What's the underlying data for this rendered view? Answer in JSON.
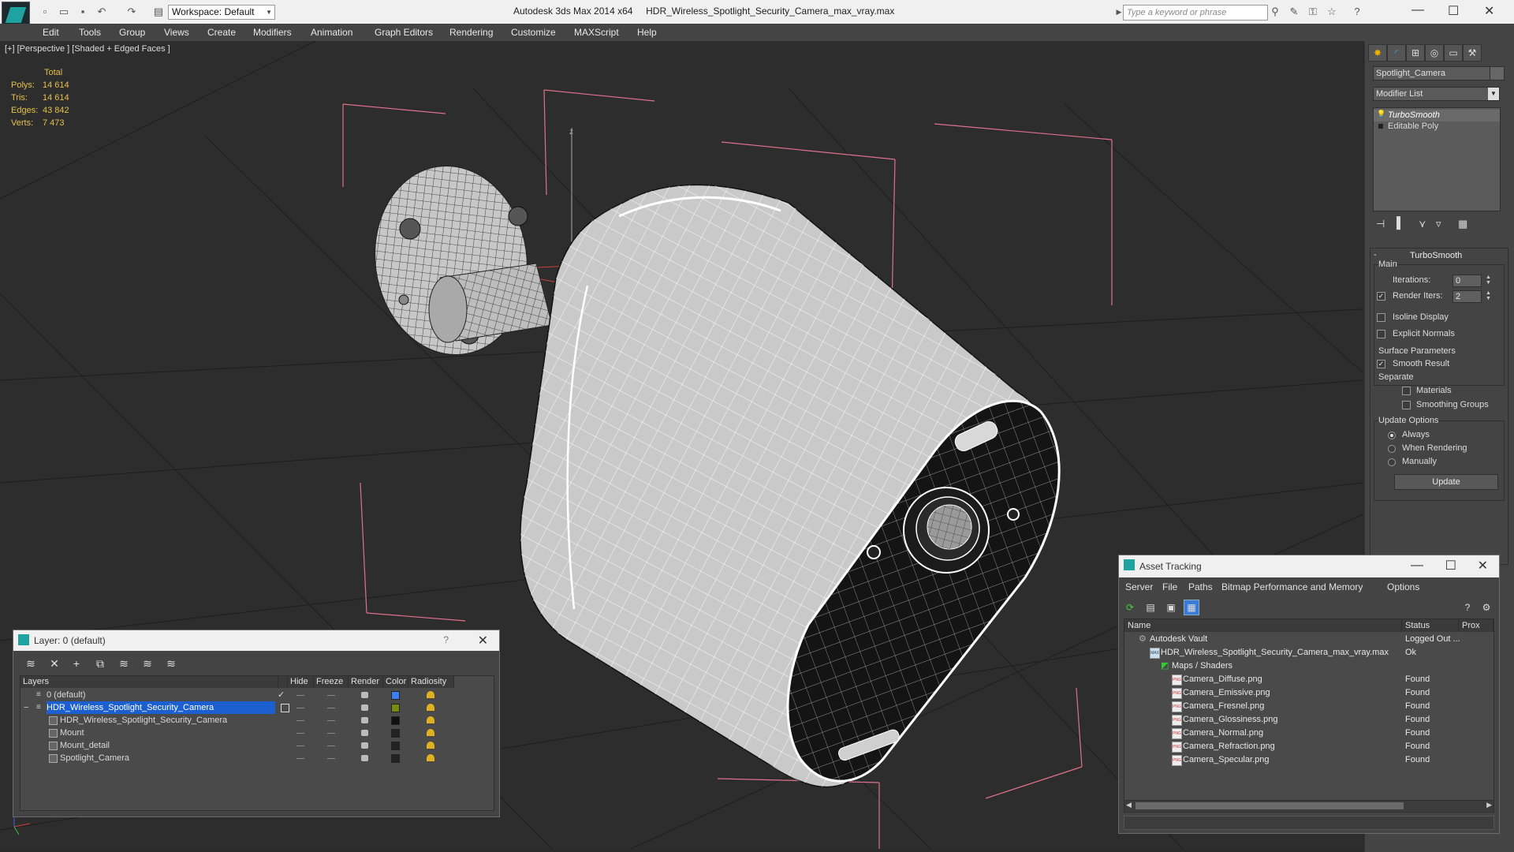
{
  "window": {
    "app_title": "Autodesk 3ds Max  2014 x64",
    "file_title": "HDR_Wireless_Spotlight_Security_Camera_max_vray.max",
    "workspace": "Workspace: Default",
    "search_placeholder": "Type a keyword or phrase"
  },
  "menu": [
    "Edit",
    "Tools",
    "Group",
    "Views",
    "Create",
    "Modifiers",
    "Animation",
    "Graph Editors",
    "Rendering",
    "Customize",
    "MAXScript",
    "Help"
  ],
  "viewport": {
    "label": "[+] [Perspective ] [Shaded + Edged Faces ]",
    "stats_header": "Total",
    "stats": [
      {
        "k": "Polys:",
        "v": "14 614"
      },
      {
        "k": "Tris:",
        "v": "14 614"
      },
      {
        "k": "Edges:",
        "v": "43 842"
      },
      {
        "k": "Verts:",
        "v": "7 473"
      }
    ],
    "colors": {
      "bg": "#2d2d2d",
      "bbox": "#e07090",
      "mesh_fill": "#c9c9c9",
      "wire": "#ffffff"
    }
  },
  "command_panel": {
    "object_name": "Spotlight_Camera",
    "modifier_list": "Modifier List",
    "stack": [
      "TurboSmooth",
      "Editable Poly"
    ],
    "rollout_title": "TurboSmooth",
    "main_group": "Main",
    "iterations_label": "Iterations:",
    "iterations_value": "0",
    "render_iters_label": "Render Iters:",
    "render_iters_value": "2",
    "render_iters_checked": true,
    "isoline_label": "Isoline Display",
    "explicit_normals_label": "Explicit Normals",
    "surface_group": "Surface Parameters",
    "smooth_result_label": "Smooth Result",
    "separate_label": "Separate",
    "materials_label": "Materials",
    "smoothing_groups_label": "Smoothing Groups",
    "update_group": "Update Options",
    "always_label": "Always",
    "when_rendering_label": "When Rendering",
    "manually_label": "Manually",
    "update_button": "Update"
  },
  "layer_dialog": {
    "title": "Layer: 0 (default)",
    "help": "?",
    "columns": [
      "Layers",
      "Hide",
      "Freeze",
      "Render",
      "Color",
      "Radiosity"
    ],
    "rows": [
      {
        "name": "0 (default)",
        "indent": 0,
        "selected": false,
        "color": "#3c7ff0"
      },
      {
        "name": "HDR_Wireless_Spotlight_Security_Camera",
        "indent": 0,
        "selected": true,
        "color": "#7a8a10"
      },
      {
        "name": "HDR_Wireless_Spotlight_Security_Camera",
        "indent": 1,
        "selected": false,
        "color": "#111111"
      },
      {
        "name": "Mount",
        "indent": 1,
        "selected": false,
        "color": "#222222"
      },
      {
        "name": "Mount_detail",
        "indent": 1,
        "selected": false,
        "color": "#222222"
      },
      {
        "name": "Spotlight_Camera",
        "indent": 1,
        "selected": false,
        "color": "#222222"
      }
    ]
  },
  "asset_dialog": {
    "title": "Asset Tracking",
    "menu": [
      "Server",
      "File",
      "Paths",
      "Bitmap Performance and Memory",
      "Options"
    ],
    "columns": [
      "Name",
      "Status",
      "Prox"
    ],
    "rows": [
      {
        "name": "Autodesk Vault",
        "status": "Logged Out ...",
        "indent": 0,
        "icon": "vault"
      },
      {
        "name": "HDR_Wireless_Spotlight_Security_Camera_max_vray.max",
        "status": "Ok",
        "indent": 1,
        "icon": "max"
      },
      {
        "name": "Maps / Shaders",
        "status": "",
        "indent": 2,
        "icon": "folder"
      },
      {
        "name": "Camera_Diffuse.png",
        "status": "Found",
        "indent": 3,
        "icon": "png"
      },
      {
        "name": "Camera_Emissive.png",
        "status": "Found",
        "indent": 3,
        "icon": "png"
      },
      {
        "name": "Camera_Fresnel.png",
        "status": "Found",
        "indent": 3,
        "icon": "png"
      },
      {
        "name": "Camera_Glossiness.png",
        "status": "Found",
        "indent": 3,
        "icon": "png"
      },
      {
        "name": "Camera_Normal.png",
        "status": "Found",
        "indent": 3,
        "icon": "png"
      },
      {
        "name": "Camera_Refraction.png",
        "status": "Found",
        "indent": 3,
        "icon": "png"
      },
      {
        "name": "Camera_Specular.png",
        "status": "Found",
        "indent": 3,
        "icon": "png"
      }
    ],
    "png_icon_text": "PNG"
  }
}
